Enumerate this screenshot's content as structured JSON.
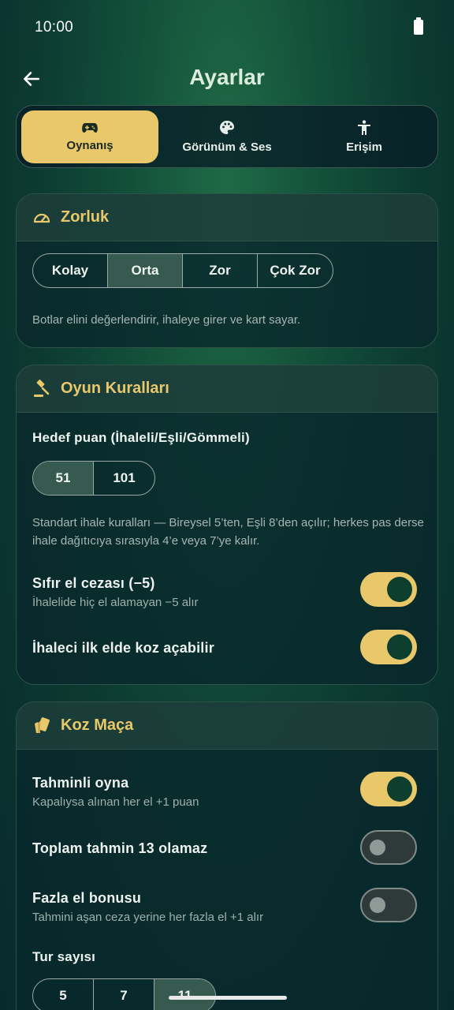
{
  "status": {
    "time": "10:00"
  },
  "header": {
    "title": "Ayarlar"
  },
  "tabs": [
    {
      "label": "Oynanış",
      "icon": "gamepad-icon",
      "active": true
    },
    {
      "label": "Görünüm & Ses",
      "icon": "palette-icon",
      "active": false
    },
    {
      "label": "Erişim",
      "icon": "accessibility-icon",
      "active": false
    }
  ],
  "difficulty": {
    "title": "Zorluk",
    "options": [
      "Kolay",
      "Orta",
      "Zor",
      "Çok Zor"
    ],
    "selected": "Orta",
    "description": "Botlar elini değerlendirir, ihaleye girer ve kart sayar."
  },
  "rules": {
    "title": "Oyun Kuralları",
    "target_label": "Hedef puan (İhaleli/Eşli/Gömmeli)",
    "target_options": [
      "51",
      "101"
    ],
    "target_selected": "51",
    "description": "Standart ihale kuralları — Bireysel 5’ten, Eşli 8’den açılır; herkes pas derse ihale dağıtıcıya sırasıyla 4’e veya 7’ye kalır.",
    "zero_penalty": {
      "label": "Sıfır el cezası (−5)",
      "sub": "İhalelide hiç el alamayan −5 alır",
      "on": true
    },
    "trump_first": {
      "label": "İhaleci ilk elde koz açabilir",
      "on": true
    }
  },
  "spades": {
    "title": "Koz Maça",
    "predicted": {
      "label": "Tahminli oyna",
      "sub": "Kapalıysa alınan her el +1 puan",
      "on": true
    },
    "not13": {
      "label": "Toplam tahmin 13 olamaz",
      "on": false
    },
    "bonus": {
      "label": "Fazla el bonusu",
      "sub": "Tahmini aşan ceza yerine her fazla el +1 alır",
      "on": false
    },
    "rounds_label": "Tur sayısı",
    "round_options": [
      "5",
      "7",
      "11"
    ],
    "round_selected": "11"
  },
  "colors": {
    "accent": "#e9c86b",
    "toggle_knob_on": "#0e3f2e",
    "card_bg": "#08282c"
  }
}
